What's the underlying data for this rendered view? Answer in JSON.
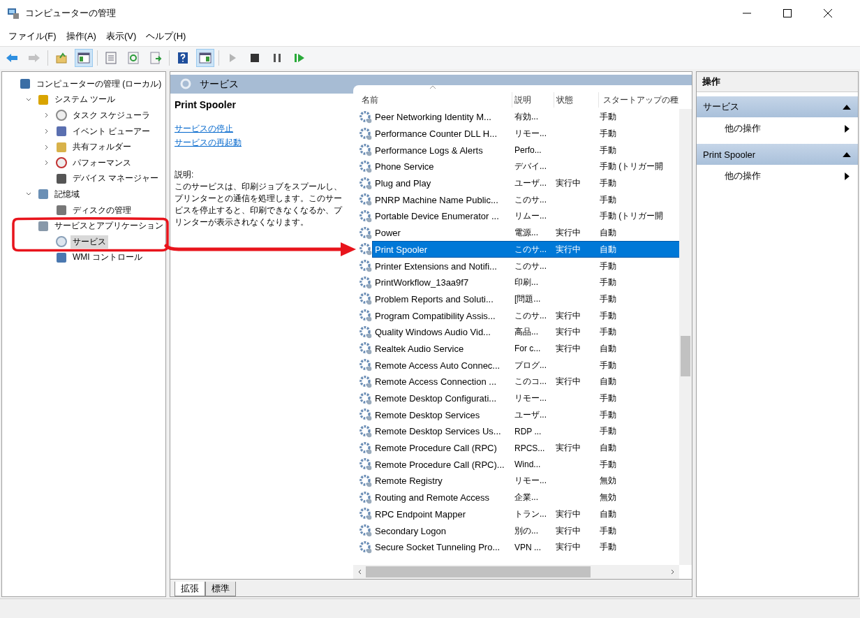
{
  "window": {
    "title": "コンピューターの管理"
  },
  "menu": [
    "ファイル(F)",
    "操作(A)",
    "表示(V)",
    "ヘルプ(H)"
  ],
  "toolbar": [
    {
      "kind": "back",
      "pressed": false,
      "disabled": false
    },
    {
      "kind": "forward",
      "pressed": false,
      "disabled": true
    },
    {
      "kind": "sep"
    },
    {
      "kind": "up",
      "pressed": false,
      "disabled": false
    },
    {
      "kind": "tree",
      "pressed": true,
      "disabled": false
    },
    {
      "kind": "sep"
    },
    {
      "kind": "props",
      "pressed": false,
      "disabled": false
    },
    {
      "kind": "refresh",
      "pressed": false,
      "disabled": false
    },
    {
      "kind": "export",
      "pressed": false,
      "disabled": false
    },
    {
      "kind": "sep"
    },
    {
      "kind": "help",
      "pressed": false,
      "disabled": false
    },
    {
      "kind": "pane",
      "pressed": true,
      "disabled": false
    },
    {
      "kind": "sep"
    },
    {
      "kind": "play",
      "pressed": false,
      "disabled": true
    },
    {
      "kind": "stop",
      "pressed": false,
      "disabled": false
    },
    {
      "kind": "pause",
      "pressed": false,
      "disabled": false
    },
    {
      "kind": "resume",
      "pressed": false,
      "disabled": false
    }
  ],
  "tree": [
    {
      "label": "コンピューターの管理 (ローカル)",
      "kind": "computer",
      "selected": false,
      "children": [
        {
          "label": "システム ツール",
          "kind": "tools",
          "expanded": true,
          "selected": false,
          "children": [
            {
              "label": "タスク スケジューラ",
              "kind": "clock",
              "expanded": false,
              "selected": false
            },
            {
              "label": "イベント ビューアー",
              "kind": "event",
              "expanded": false,
              "selected": false
            },
            {
              "label": "共有フォルダー",
              "kind": "share",
              "expanded": false,
              "selected": false
            },
            {
              "label": "パフォーマンス",
              "kind": "perf",
              "expanded": false,
              "selected": false
            },
            {
              "label": "デバイス マネージャー",
              "kind": "device",
              "selected": false
            }
          ]
        },
        {
          "label": "記憶域",
          "kind": "storage",
          "expanded": true,
          "selected": false,
          "children": [
            {
              "label": "ディスクの管理",
              "kind": "disk",
              "selected": false
            }
          ]
        },
        {
          "label": "サービスとアプリケーション",
          "kind": "apps",
          "selected": false,
          "children": [
            {
              "label": "サービス",
              "kind": "services",
              "selected": true
            },
            {
              "label": "WMI コントロール",
              "kind": "wmi",
              "selected": false
            }
          ]
        }
      ]
    }
  ],
  "center": {
    "title": "サービス",
    "service_name": "Print Spooler",
    "links": [
      "サービスの停止",
      "サービスの再起動"
    ],
    "description_label": "説明:",
    "description": "このサービスは、印刷ジョブをスプールし、プリンターとの通信を処理します。このサービスを停止すると、印刷できなくなるか、プリンターが表示されなくなります。"
  },
  "table": {
    "columns": [
      "名前",
      "説明",
      "状態",
      "スタートアップの種"
    ],
    "rows": [
      {
        "name": "Peer Networking Identity M...",
        "desc": "有効...",
        "status": "",
        "startup": "手動",
        "selected": false
      },
      {
        "name": "Performance Counter DLL H...",
        "desc": "リモー...",
        "status": "",
        "startup": "手動",
        "selected": false
      },
      {
        "name": "Performance Logs & Alerts",
        "desc": "Perfo...",
        "status": "",
        "startup": "手動",
        "selected": false
      },
      {
        "name": "Phone Service",
        "desc": "デバイ...",
        "status": "",
        "startup": "手動 (トリガー開",
        "selected": false
      },
      {
        "name": "Plug and Play",
        "desc": "ユーザ...",
        "status": "実行中",
        "startup": "手動",
        "selected": false
      },
      {
        "name": "PNRP Machine Name Public...",
        "desc": "このサ...",
        "status": "",
        "startup": "手動",
        "selected": false
      },
      {
        "name": "Portable Device Enumerator ...",
        "desc": "リムー...",
        "status": "",
        "startup": "手動 (トリガー開",
        "selected": false
      },
      {
        "name": "Power",
        "desc": "電源...",
        "status": "実行中",
        "startup": "自動",
        "selected": false
      },
      {
        "name": "Print Spooler",
        "desc": "このサ...",
        "status": "実行中",
        "startup": "自動",
        "selected": true
      },
      {
        "name": "Printer Extensions and Notifi...",
        "desc": "このサ...",
        "status": "",
        "startup": "手動",
        "selected": false
      },
      {
        "name": "PrintWorkflow_13aa9f7",
        "desc": "印刷...",
        "status": "",
        "startup": "手動",
        "selected": false
      },
      {
        "name": "Problem Reports and Soluti...",
        "desc": "[問題...",
        "status": "",
        "startup": "手動",
        "selected": false
      },
      {
        "name": "Program Compatibility Assis...",
        "desc": "このサ...",
        "status": "実行中",
        "startup": "手動",
        "selected": false
      },
      {
        "name": "Quality Windows Audio Vid...",
        "desc": "高品...",
        "status": "実行中",
        "startup": "手動",
        "selected": false
      },
      {
        "name": "Realtek Audio Service",
        "desc": "For c...",
        "status": "実行中",
        "startup": "自動",
        "selected": false
      },
      {
        "name": "Remote Access Auto Connec...",
        "desc": "プログ...",
        "status": "",
        "startup": "手動",
        "selected": false
      },
      {
        "name": "Remote Access Connection ...",
        "desc": "このコ...",
        "status": "実行中",
        "startup": "自動",
        "selected": false
      },
      {
        "name": "Remote Desktop Configurati...",
        "desc": "リモー...",
        "status": "",
        "startup": "手動",
        "selected": false
      },
      {
        "name": "Remote Desktop Services",
        "desc": "ユーザ...",
        "status": "",
        "startup": "手動",
        "selected": false
      },
      {
        "name": "Remote Desktop Services Us...",
        "desc": "RDP ...",
        "status": "",
        "startup": "手動",
        "selected": false
      },
      {
        "name": "Remote Procedure Call (RPC)",
        "desc": "RPCS...",
        "status": "実行中",
        "startup": "自動",
        "selected": false
      },
      {
        "name": "Remote Procedure Call (RPC)...",
        "desc": "Wind...",
        "status": "",
        "startup": "手動",
        "selected": false
      },
      {
        "name": "Remote Registry",
        "desc": "リモー...",
        "status": "",
        "startup": "無効",
        "selected": false
      },
      {
        "name": "Routing and Remote Access",
        "desc": "企業...",
        "status": "",
        "startup": "無効",
        "selected": false
      },
      {
        "name": "RPC Endpoint Mapper",
        "desc": "トラン...",
        "status": "実行中",
        "startup": "自動",
        "selected": false
      },
      {
        "name": "Secondary Logon",
        "desc": "別の...",
        "status": "実行中",
        "startup": "手動",
        "selected": false
      },
      {
        "name": "Secure Socket Tunneling Pro...",
        "desc": "VPN ...",
        "status": "実行中",
        "startup": "手動",
        "selected": false
      }
    ]
  },
  "view_tabs": [
    {
      "label": "拡張",
      "selected": true
    },
    {
      "label": "標準",
      "selected": false
    }
  ],
  "actions": {
    "title": "操作",
    "sections": [
      {
        "title": "サービス",
        "expanded": true,
        "items": [
          "他の操作"
        ]
      },
      {
        "title": "Print Spooler",
        "expanded": true,
        "items": [
          "他の操作"
        ]
      }
    ]
  }
}
